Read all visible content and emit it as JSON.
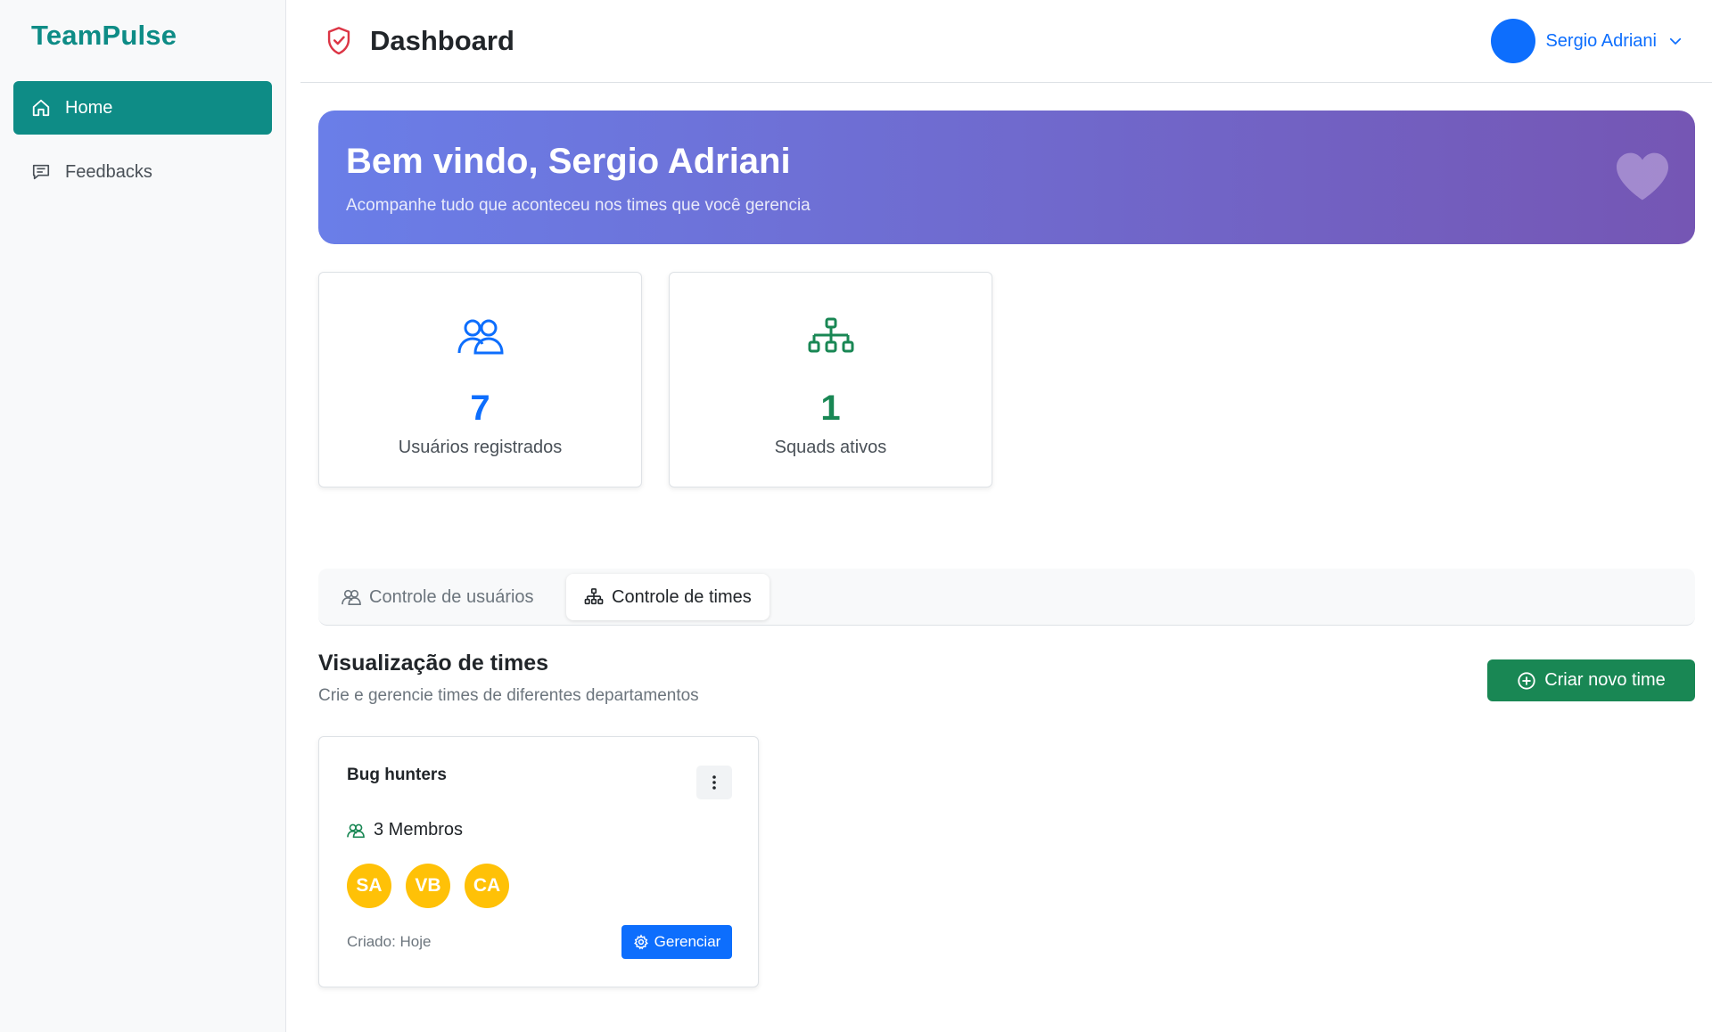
{
  "app": {
    "brand": "TeamPulse"
  },
  "sidebar": {
    "items": [
      {
        "label": "Home",
        "icon": "home-icon",
        "active": true
      },
      {
        "label": "Feedbacks",
        "icon": "chat-icon",
        "active": false
      }
    ]
  },
  "header": {
    "title": "Dashboard",
    "user_name": "Sergio Adriani"
  },
  "banner": {
    "title": "Bem vindo, Sergio Adriani",
    "subtitle": "Acompanhe tudo que aconteceu nos times que você gerencia"
  },
  "stats": [
    {
      "value": "7",
      "label": "Usuários registrados",
      "icon": "users-icon",
      "color": "#0d6efd"
    },
    {
      "value": "1",
      "label": "Squads ativos",
      "icon": "org-chart-icon",
      "color": "#198754"
    }
  ],
  "tabs": [
    {
      "label": "Controle de usuários",
      "active": false
    },
    {
      "label": "Controle de times",
      "active": true
    }
  ],
  "section": {
    "title": "Visualização de times",
    "subtitle": "Crie e gerencie times de diferentes departamentos",
    "create_label": "Criar novo time"
  },
  "teams": [
    {
      "name": "Bug hunters",
      "members_label": "3 Membros",
      "avatars": [
        "SA",
        "VB",
        "CA"
      ],
      "created": "Criado: Hoje",
      "manage_label": "Gerenciar"
    }
  ],
  "colors": {
    "brand": "#0e8c86",
    "primary": "#0d6efd",
    "success": "#198754",
    "avatar": "#ffc107",
    "banner_start": "#6a7ee8",
    "banner_end": "#7556b4"
  }
}
